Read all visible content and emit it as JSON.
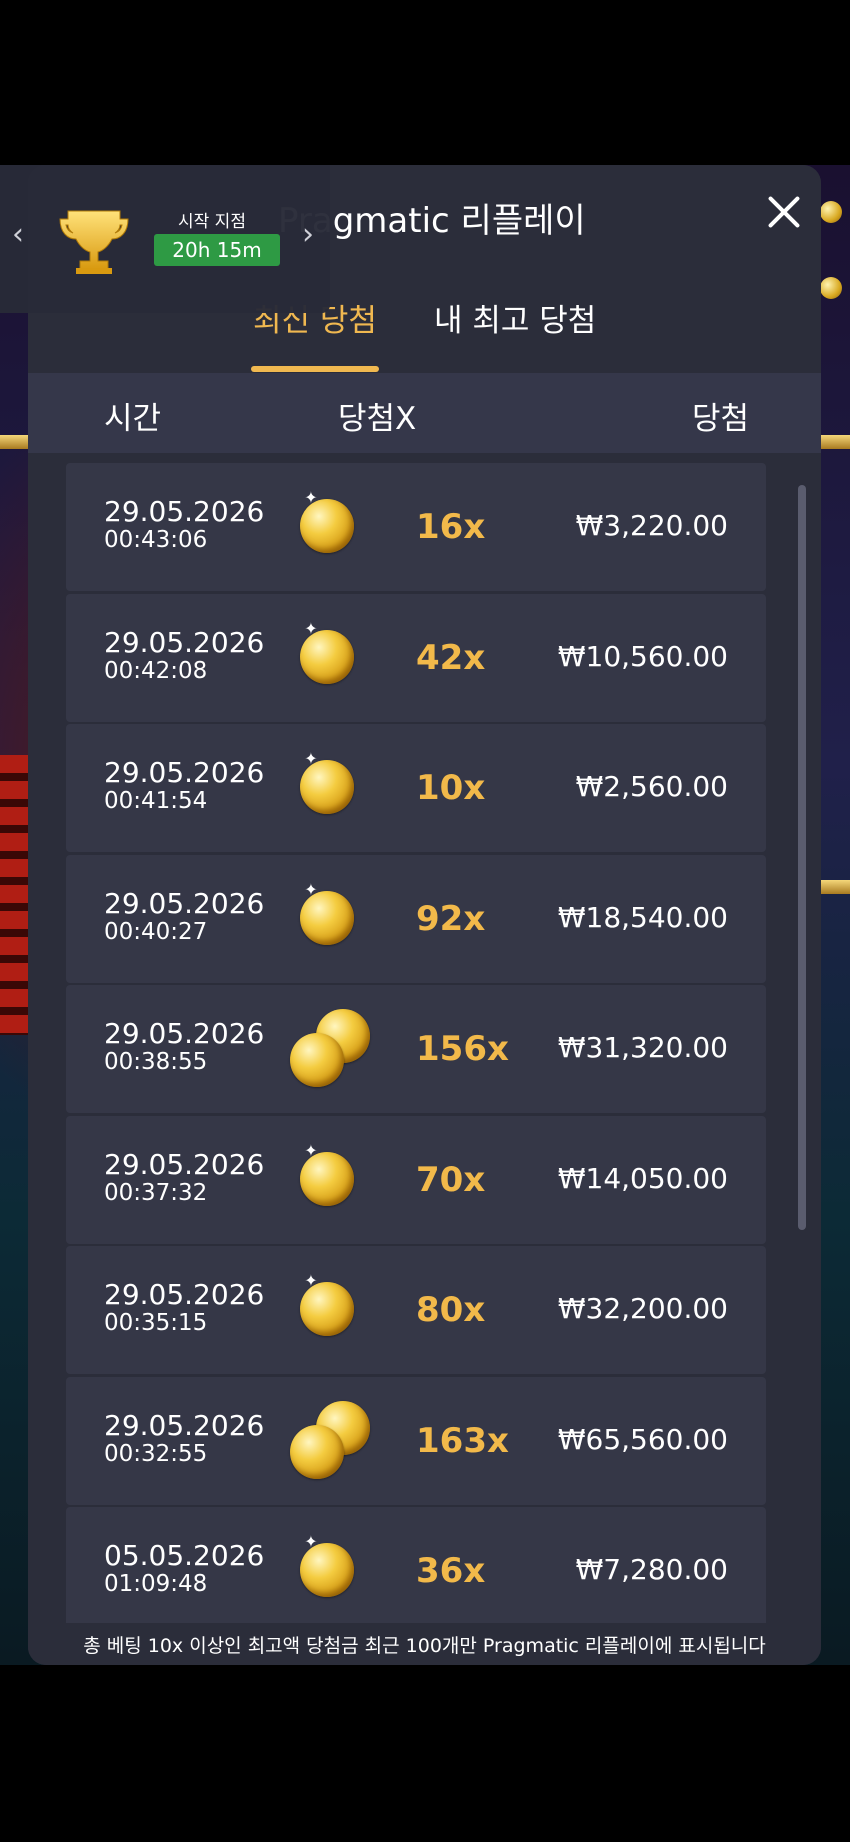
{
  "header": {
    "title": "Pragmatic 리플레이",
    "close_icon": "close-icon"
  },
  "tabs": [
    {
      "label": "최신 당첨",
      "active": true
    },
    {
      "label": "내 최고 당첨",
      "active": false
    }
  ],
  "columns": {
    "time": "시간",
    "multiplier": "당첨X",
    "win": "당첨"
  },
  "rows": [
    {
      "date": "29.05.2026",
      "time": "00:43:06",
      "multiplier": "16x",
      "amount": "₩3,220.00",
      "coins": 1
    },
    {
      "date": "29.05.2026",
      "time": "00:42:08",
      "multiplier": "42x",
      "amount": "₩10,560.00",
      "coins": 1
    },
    {
      "date": "29.05.2026",
      "time": "00:41:54",
      "multiplier": "10x",
      "amount": "₩2,560.00",
      "coins": 1
    },
    {
      "date": "29.05.2026",
      "time": "00:40:27",
      "multiplier": "92x",
      "amount": "₩18,540.00",
      "coins": 1
    },
    {
      "date": "29.05.2026",
      "time": "00:38:55",
      "multiplier": "156x",
      "amount": "₩31,320.00",
      "coins": 2
    },
    {
      "date": "29.05.2026",
      "time": "00:37:32",
      "multiplier": "70x",
      "amount": "₩14,050.00",
      "coins": 1
    },
    {
      "date": "29.05.2026",
      "time": "00:35:15",
      "multiplier": "80x",
      "amount": "₩32,200.00",
      "coins": 1
    },
    {
      "date": "29.05.2026",
      "time": "00:32:55",
      "multiplier": "163x",
      "amount": "₩65,560.00",
      "coins": 2
    },
    {
      "date": "05.05.2026",
      "time": "01:09:48",
      "multiplier": "36x",
      "amount": "₩7,280.00",
      "coins": 1
    }
  ],
  "footer": {
    "note": "총 베팅 10x 이상인 최고액 당첨금 최근 100개만 Pragmatic 리플레이에 표시됩니다"
  },
  "tournament": {
    "label": "시작 지점",
    "countdown": "20h 15m",
    "icon": "trophy-icon",
    "prev_arrow": "‹",
    "next_arrow": "›"
  },
  "colors": {
    "accent": "#f0b850",
    "panel": "#2b2d3a",
    "row": "#353747",
    "badge": "#2e9a44"
  }
}
